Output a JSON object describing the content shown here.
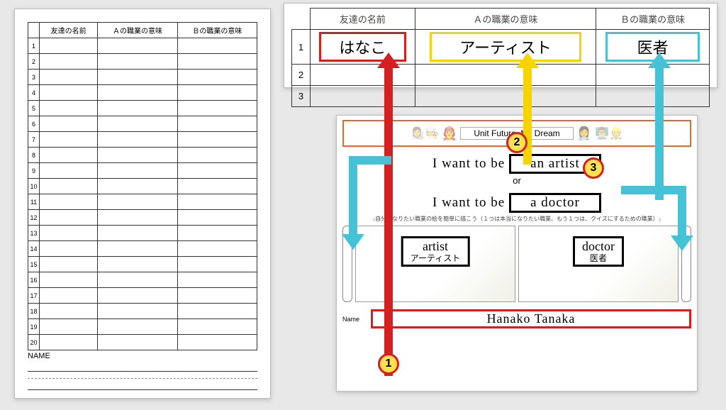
{
  "left_sheet": {
    "headers": [
      "友達の名前",
      "Ａの職業の意味",
      "Ｂの職業の意味"
    ],
    "row_count": 20,
    "name_label": "NAME"
  },
  "zoom_table": {
    "headers": [
      "友達の名前",
      "Ａの職業の意味",
      "Ｂの職業の意味"
    ],
    "row_numbers": [
      "1",
      "2",
      "3"
    ],
    "answers": {
      "name": "はなこ",
      "job_a": "アーティスト",
      "job_b": "医者"
    }
  },
  "lesson_sheet": {
    "unit_title": "Unit    Future, My Dream",
    "line1_prefix": "I want to be",
    "line1_fill": "an  artist",
    "or_label": "or",
    "line2_prefix": "I want to be",
    "line2_fill": "a  doctor",
    "instruction": "↓自分がなりたい職業の絵を簡単に描こう（１つは本当になりたい職業、もう１つは、クイズにするための職業）↓",
    "card_a": {
      "en": "artist",
      "jp": "アーティスト"
    },
    "card_b": {
      "en": "doctor",
      "jp": "医者"
    },
    "name_label": "Name",
    "student_name": "Hanako Tanaka"
  },
  "badges": {
    "one": "1",
    "two": "2",
    "three": "3"
  },
  "colors": {
    "red": "#d42020",
    "yellow": "#f7d400",
    "cyan": "#46c2d6",
    "accent_orange": "#e06a2a"
  }
}
